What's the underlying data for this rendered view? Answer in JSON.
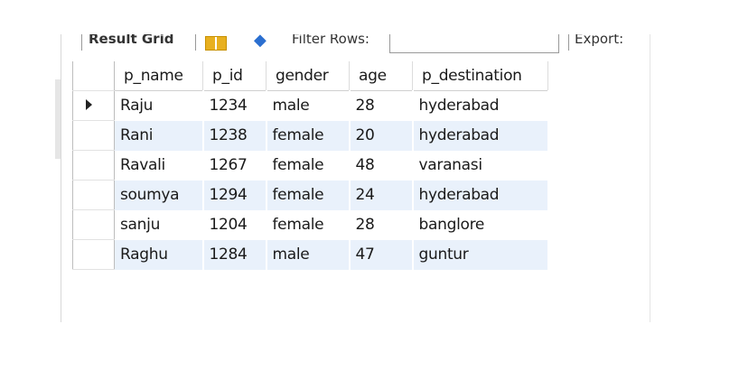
{
  "toolbar": {
    "result_grid": "Result Grid",
    "filter_label": "Filter Rows:",
    "filter_value": "",
    "export_label": "Export:"
  },
  "table": {
    "columns": [
      "p_name",
      "p_id",
      "gender",
      "age",
      "p_destination"
    ],
    "rows": [
      [
        "Raju",
        "1234",
        "male",
        "28",
        "hyderabad"
      ],
      [
        "Rani",
        "1238",
        "female",
        "20",
        "hyderabad"
      ],
      [
        "Ravali",
        "1267",
        "female",
        "48",
        "varanasi"
      ],
      [
        "soumya",
        "1294",
        "female",
        "24",
        "hyderabad"
      ],
      [
        "sanju",
        "1204",
        "female",
        "28",
        "banglore"
      ],
      [
        "Raghu",
        "1284",
        "male",
        "47",
        "guntur"
      ]
    ],
    "selected_row": 0
  },
  "colors": {
    "alt_row": "#e9f1fb"
  }
}
